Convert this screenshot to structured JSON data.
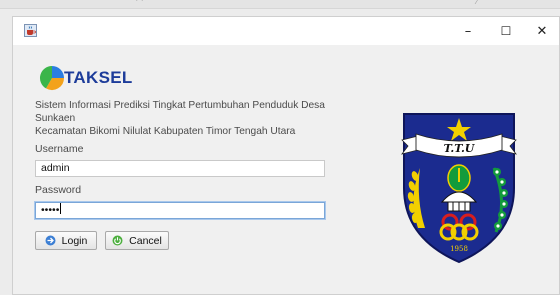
{
  "window": {
    "minimize_glyph": "–",
    "maximize_glyph": "☐",
    "close_glyph": "✕"
  },
  "header": {
    "app_title": "TAKSEL",
    "description_line1": "Sistem Informasi Prediksi Tingkat Pertumbuhan Penduduk Desa Sunkaen",
    "description_line2": "Kecamatan Bikomi Nilulat Kabupaten Timor Tengah Utara"
  },
  "form": {
    "username_label": "Username",
    "username_value": "admin",
    "password_label": "Password",
    "password_masked": "•••••"
  },
  "buttons": {
    "login_label": "Login",
    "cancel_label": "Cancel"
  },
  "emblem": {
    "banner_text": "T.T.U",
    "year_text": "1958"
  },
  "colors": {
    "title_blue": "#1d3c9a",
    "shield_blue": "#1b2b8f",
    "gold": "#f2d000",
    "green": "#139b3c",
    "red": "#d81e1e"
  },
  "icons": {
    "app_icon": "java-coffee-icon",
    "logo": "pie-logo-icon",
    "login_icon": "arrow-right-icon",
    "cancel_icon": "power-icon"
  }
}
